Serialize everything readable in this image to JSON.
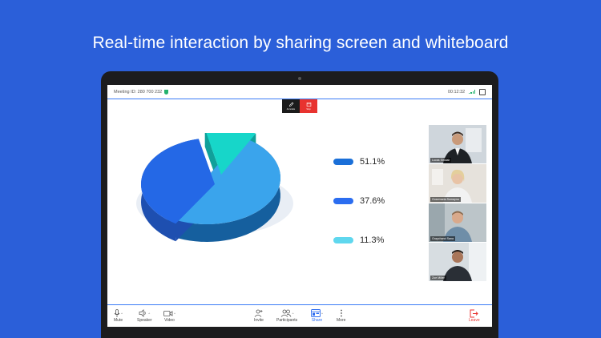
{
  "headline": "Real-time interaction by sharing screen and whiteboard",
  "meeting": {
    "id_label": "Meeting ID: 280 700 232",
    "timer": "00:12:32"
  },
  "annotation": {
    "annotate_label": "Annotate",
    "stop_label": "Stop"
  },
  "chart_data": {
    "type": "pie",
    "values": [
      51.1,
      37.6,
      11.3
    ],
    "labels": [
      "51.1%",
      "37.6%",
      "11.3%"
    ],
    "colors": [
      "#1a6fd8",
      "#2b6df0",
      "#5fd7ee"
    ]
  },
  "participants": [
    {
      "name": "Lucas Sinclair"
    },
    {
      "name": "Gosemaria Sumayna"
    },
    {
      "name": "Graychand Sana"
    },
    {
      "name": "Zoe Miller"
    }
  ],
  "toolbar": {
    "mute": "Mute",
    "speaker": "Speaker",
    "video": "Video",
    "invite": "Invite",
    "participants": "Participants",
    "share": "Share",
    "more": "More",
    "leave": "Leave"
  },
  "colors": {
    "background": "#2b5fd9",
    "accent": "#2d6cf0",
    "leave": "#e8332f",
    "secure": "#23b26d"
  }
}
